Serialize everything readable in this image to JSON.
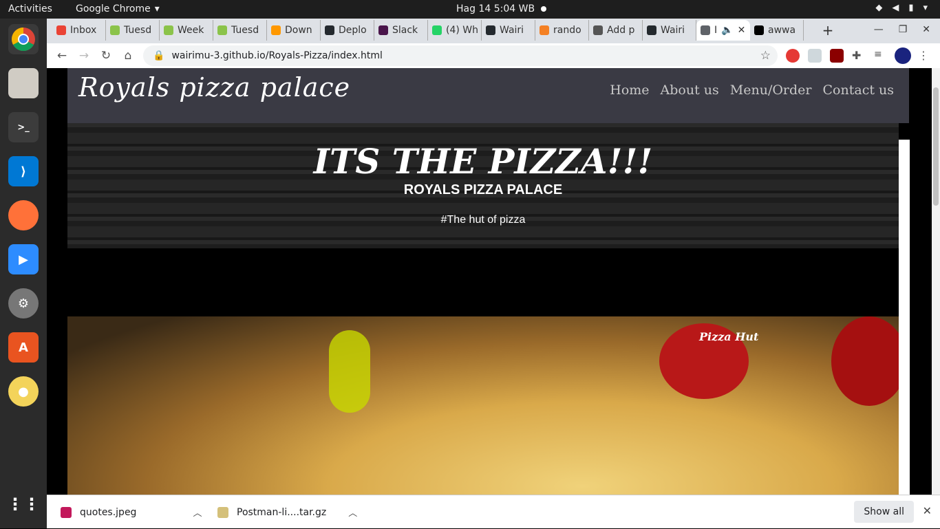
{
  "system_bar": {
    "activities": "Activities",
    "app_name": "Google Chrome",
    "clock": "Hag 14  5:04 WB"
  },
  "tabs": [
    {
      "label": "Inbox",
      "fav_color": "#ea4335"
    },
    {
      "label": "Tuesd",
      "fav_color": "#8bc34a"
    },
    {
      "label": "Week",
      "fav_color": "#8bc34a"
    },
    {
      "label": "Tuesd",
      "fav_color": "#8bc34a"
    },
    {
      "label": "Down",
      "fav_color": "#ff9800"
    },
    {
      "label": "Deplo",
      "fav_color": "#24292e"
    },
    {
      "label": "Slack",
      "fav_color": "#4a154b"
    },
    {
      "label": "(4) Wh",
      "fav_color": "#25d366"
    },
    {
      "label": "Wairi",
      "fav_color": "#24292e"
    },
    {
      "label": "rando",
      "fav_color": "#f48024"
    },
    {
      "label": "Add p",
      "fav_color": "#555555"
    },
    {
      "label": "Wairi",
      "fav_color": "#24292e"
    },
    {
      "label": "I",
      "fav_color": "#5f6368"
    },
    {
      "label": "awwa",
      "fav_color": "#000000"
    }
  ],
  "active_tab_index": 12,
  "address_bar": {
    "url": "wairimu-3.github.io/Royals-Pizza/index.html"
  },
  "site": {
    "logo": "Royals pizza palace",
    "nav": [
      "Home",
      "About us",
      "Menu/Order",
      "Contact us"
    ],
    "hero_title": "ITS THE PIZZA!!!",
    "hero_subtitle": "ROYALS PIZZA PALACE",
    "hero_tagline": "#The hut of pizza",
    "image_brand": "Pizza Hut"
  },
  "downloads": {
    "items": [
      {
        "name": "quotes.jpeg",
        "icon_color": "#c2185b"
      },
      {
        "name": "Postman-li....tar.gz",
        "icon_color": "#d4c07a"
      }
    ],
    "show_all": "Show all"
  }
}
